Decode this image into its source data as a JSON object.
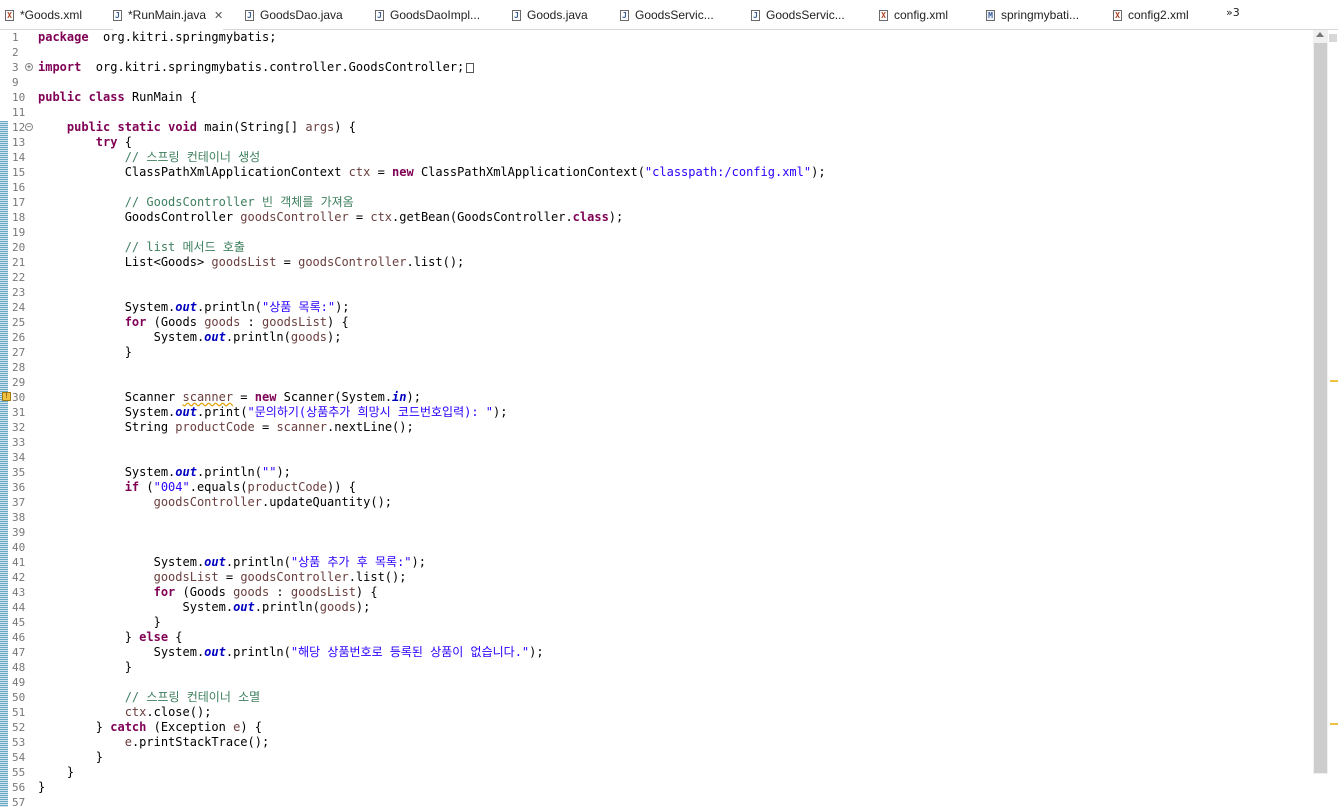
{
  "tabs": [
    {
      "label": "*Goods.xml",
      "icon": "xml-file-icon",
      "type": "x",
      "active": false
    },
    {
      "label": "*RunMain.java",
      "icon": "java-file-icon",
      "type": "j",
      "active": true,
      "close": "✕"
    },
    {
      "label": "GoodsDao.java",
      "icon": "java-file-icon",
      "type": "j",
      "active": false
    },
    {
      "label": "GoodsDaoImpl...",
      "icon": "java-file-icon",
      "type": "j",
      "active": false
    },
    {
      "label": "Goods.java",
      "icon": "java-file-icon",
      "type": "j",
      "active": false
    },
    {
      "label": "GoodsServic...",
      "icon": "java-file-icon",
      "type": "j",
      "active": false
    },
    {
      "label": "GoodsServic...",
      "icon": "java-file-icon",
      "type": "j",
      "active": false
    },
    {
      "label": "config.xml",
      "icon": "xml-file-icon",
      "type": "x",
      "active": false
    },
    {
      "label": "springmybati...",
      "icon": "maven-file-icon",
      "type": "m",
      "active": false
    },
    {
      "label": "config2.xml",
      "icon": "xml-file-icon",
      "type": "x",
      "active": false
    }
  ],
  "overflow_label": "»3",
  "code_lines": [
    {
      "n": "1",
      "segs": [
        [
          "kw",
          "package"
        ],
        [
          "",
          "  org.kitri.springmybatis;"
        ]
      ]
    },
    {
      "n": "2",
      "segs": []
    },
    {
      "n": "3",
      "fold": "+",
      "segs": [
        [
          "kw",
          "import"
        ],
        [
          "",
          "  org.kitri.springmybatis.controller.GoodsController;"
        ]
      ],
      "foldbox": true
    },
    {
      "n": "9",
      "segs": []
    },
    {
      "n": "10",
      "segs": [
        [
          "kw",
          "public"
        ],
        [
          "",
          " "
        ],
        [
          "kw",
          "class"
        ],
        [
          "",
          " RunMain {"
        ]
      ]
    },
    {
      "n": "11",
      "segs": []
    },
    {
      "n": "12",
      "fold": "-",
      "segs": [
        [
          "",
          "    "
        ],
        [
          "kw",
          "public"
        ],
        [
          "",
          " "
        ],
        [
          "kw",
          "static"
        ],
        [
          "",
          " "
        ],
        [
          "kw",
          "void"
        ],
        [
          "",
          " main(String[] "
        ],
        [
          "var",
          "args"
        ],
        [
          "",
          ") {"
        ]
      ]
    },
    {
      "n": "13",
      "segs": [
        [
          "",
          "        "
        ],
        [
          "kw",
          "try"
        ],
        [
          "",
          " {"
        ]
      ]
    },
    {
      "n": "14",
      "segs": [
        [
          "",
          "            "
        ],
        [
          "cmt",
          "// 스프링 컨테이너 생성"
        ]
      ]
    },
    {
      "n": "15",
      "segs": [
        [
          "",
          "            ClassPathXmlApplicationContext "
        ],
        [
          "var",
          "ctx"
        ],
        [
          "",
          " = "
        ],
        [
          "kw",
          "new"
        ],
        [
          "",
          " ClassPathXmlApplicationContext("
        ],
        [
          "str",
          "\"classpath:/config.xml\""
        ],
        [
          "",
          ");"
        ]
      ]
    },
    {
      "n": "16",
      "segs": []
    },
    {
      "n": "17",
      "segs": [
        [
          "",
          "            "
        ],
        [
          "cmt",
          "// GoodsController 빈 객체를 가져옴"
        ]
      ]
    },
    {
      "n": "18",
      "segs": [
        [
          "",
          "            GoodsController "
        ],
        [
          "var",
          "goodsController"
        ],
        [
          "",
          " = "
        ],
        [
          "var",
          "ctx"
        ],
        [
          "",
          ".getBean(GoodsController."
        ],
        [
          "kw",
          "class"
        ],
        [
          "",
          ");"
        ]
      ]
    },
    {
      "n": "19",
      "segs": []
    },
    {
      "n": "20",
      "segs": [
        [
          "",
          "            "
        ],
        [
          "cmt",
          "// list 메서드 호출"
        ]
      ]
    },
    {
      "n": "21",
      "segs": [
        [
          "",
          "            List<Goods> "
        ],
        [
          "var",
          "goodsList"
        ],
        [
          "",
          " = "
        ],
        [
          "var",
          "goodsController"
        ],
        [
          "",
          ".list();"
        ]
      ]
    },
    {
      "n": "22",
      "segs": []
    },
    {
      "n": "23",
      "segs": []
    },
    {
      "n": "24",
      "segs": [
        [
          "",
          "            System."
        ],
        [
          "fld",
          "out"
        ],
        [
          "",
          ".println("
        ],
        [
          "str",
          "\"상품 목록:\""
        ],
        [
          "",
          ");"
        ]
      ]
    },
    {
      "n": "25",
      "segs": [
        [
          "",
          "            "
        ],
        [
          "kw",
          "for"
        ],
        [
          "",
          " (Goods "
        ],
        [
          "var",
          "goods"
        ],
        [
          "",
          " : "
        ],
        [
          "var",
          "goodsList"
        ],
        [
          "",
          ") {"
        ]
      ]
    },
    {
      "n": "26",
      "segs": [
        [
          "",
          "                System."
        ],
        [
          "fld",
          "out"
        ],
        [
          "",
          ".println("
        ],
        [
          "var",
          "goods"
        ],
        [
          "",
          ");"
        ]
      ]
    },
    {
      "n": "27",
      "segs": [
        [
          "",
          "            }"
        ]
      ]
    },
    {
      "n": "28",
      "segs": []
    },
    {
      "n": "29",
      "segs": []
    },
    {
      "n": "30",
      "warn": true,
      "segs": [
        [
          "",
          "            Scanner "
        ],
        [
          "var warnul",
          "scanner"
        ],
        [
          "",
          " = "
        ],
        [
          "kw",
          "new"
        ],
        [
          "",
          " Scanner(System."
        ],
        [
          "fld",
          "in"
        ],
        [
          "",
          ");"
        ]
      ]
    },
    {
      "n": "31",
      "segs": [
        [
          "",
          "            System."
        ],
        [
          "fld",
          "out"
        ],
        [
          "",
          ".print("
        ],
        [
          "str",
          "\"문의하기(상품추가 희망시 코드번호입력): \""
        ],
        [
          "",
          ");"
        ]
      ]
    },
    {
      "n": "32",
      "segs": [
        [
          "",
          "            String "
        ],
        [
          "var",
          "productCode"
        ],
        [
          "",
          " = "
        ],
        [
          "var",
          "scanner"
        ],
        [
          "",
          ".nextLine();"
        ]
      ]
    },
    {
      "n": "33",
      "segs": []
    },
    {
      "n": "34",
      "segs": []
    },
    {
      "n": "35",
      "segs": [
        [
          "",
          "            System."
        ],
        [
          "fld",
          "out"
        ],
        [
          "",
          ".println("
        ],
        [
          "str",
          "\"\""
        ],
        [
          "",
          ");"
        ]
      ]
    },
    {
      "n": "36",
      "segs": [
        [
          "",
          "            "
        ],
        [
          "kw",
          "if"
        ],
        [
          "",
          " ("
        ],
        [
          "str",
          "\"004\""
        ],
        [
          "",
          ".equals("
        ],
        [
          "var",
          "productCode"
        ],
        [
          "",
          ")) {"
        ]
      ]
    },
    {
      "n": "37",
      "segs": [
        [
          "",
          "                "
        ],
        [
          "var",
          "goodsController"
        ],
        [
          "",
          ".updateQuantity();"
        ]
      ]
    },
    {
      "n": "38",
      "segs": []
    },
    {
      "n": "39",
      "segs": []
    },
    {
      "n": "40",
      "segs": []
    },
    {
      "n": "41",
      "segs": [
        [
          "",
          "                System."
        ],
        [
          "fld",
          "out"
        ],
        [
          "",
          ".println("
        ],
        [
          "str",
          "\"상품 추가 후 목록:\""
        ],
        [
          "",
          ");"
        ]
      ]
    },
    {
      "n": "42",
      "segs": [
        [
          "",
          "                "
        ],
        [
          "var",
          "goodsList"
        ],
        [
          "",
          " = "
        ],
        [
          "var",
          "goodsController"
        ],
        [
          "",
          ".list();"
        ]
      ]
    },
    {
      "n": "43",
      "segs": [
        [
          "",
          "                "
        ],
        [
          "kw",
          "for"
        ],
        [
          "",
          " (Goods "
        ],
        [
          "var",
          "goods"
        ],
        [
          "",
          " : "
        ],
        [
          "var",
          "goodsList"
        ],
        [
          "",
          ") {"
        ]
      ]
    },
    {
      "n": "44",
      "segs": [
        [
          "",
          "                    System."
        ],
        [
          "fld",
          "out"
        ],
        [
          "",
          ".println("
        ],
        [
          "var",
          "goods"
        ],
        [
          "",
          ");"
        ]
      ]
    },
    {
      "n": "45",
      "segs": [
        [
          "",
          "                }"
        ]
      ]
    },
    {
      "n": "46",
      "segs": [
        [
          "",
          "            } "
        ],
        [
          "kw",
          "else"
        ],
        [
          "",
          " {"
        ]
      ]
    },
    {
      "n": "47",
      "segs": [
        [
          "",
          "                System."
        ],
        [
          "fld",
          "out"
        ],
        [
          "",
          ".println("
        ],
        [
          "str",
          "\"해당 상품번호로 등록된 상품이 없습니다.\""
        ],
        [
          "",
          ");"
        ]
      ]
    },
    {
      "n": "48",
      "segs": [
        [
          "",
          "            }"
        ]
      ]
    },
    {
      "n": "49",
      "segs": []
    },
    {
      "n": "50",
      "segs": [
        [
          "",
          "            "
        ],
        [
          "cmt",
          "// 스프링 컨테이너 소멸"
        ]
      ]
    },
    {
      "n": "51",
      "segs": [
        [
          "",
          "            "
        ],
        [
          "var",
          "ctx"
        ],
        [
          "",
          ".close();"
        ]
      ]
    },
    {
      "n": "52",
      "segs": [
        [
          "",
          "        } "
        ],
        [
          "kw",
          "catch"
        ],
        [
          "",
          " (Exception "
        ],
        [
          "var",
          "e"
        ],
        [
          "",
          ") {"
        ]
      ]
    },
    {
      "n": "53",
      "segs": [
        [
          "",
          "            "
        ],
        [
          "var",
          "e"
        ],
        [
          "",
          ".printStackTrace();"
        ]
      ]
    },
    {
      "n": "54",
      "segs": [
        [
          "",
          "        }"
        ]
      ]
    },
    {
      "n": "55",
      "segs": [
        [
          "",
          "    }"
        ]
      ]
    },
    {
      "n": "56",
      "segs": [
        [
          "",
          "}"
        ]
      ]
    },
    {
      "n": "57",
      "segs": []
    }
  ],
  "colors": {
    "keyword": "#7f0055",
    "string": "#2a00ff",
    "comment": "#3f7f5f",
    "field": "#0000c0",
    "variable": "#6a3e3e"
  }
}
